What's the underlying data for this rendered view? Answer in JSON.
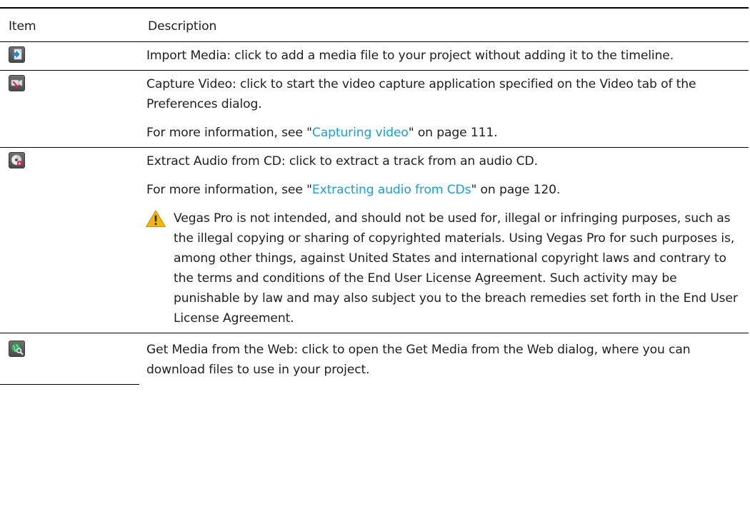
{
  "table": {
    "header": {
      "item": "Item",
      "description": "Description"
    },
    "rows": [
      {
        "icon": "import-media-icon",
        "paragraphs": [
          "Import Media: click to add a media file to your project without adding it to the timeline."
        ]
      },
      {
        "icon": "capture-video-icon",
        "paragraphs": [
          "Capture Video: click to start the video capture application specified on the Video tab of the Preferences dialog."
        ],
        "more_info": {
          "prefix": "For more information, see \"",
          "link": "Capturing video",
          "suffix": "\" on page 111."
        }
      },
      {
        "icon": "extract-audio-cd-icon",
        "paragraphs": [
          "Extract Audio from CD: click to extract a track from an audio CD."
        ],
        "more_info": {
          "prefix": "For more information, see \"",
          "link": "Extracting audio from CDs",
          "suffix": "\" on page 120."
        },
        "warning": {
          "icon": "warning-icon",
          "text": "Vegas Pro is not intended, and should not be used for, illegal or infringing purposes, such as the illegal copying or sharing of copyrighted materials. Using Vegas Pro for such purposes is, among other things, against United States and international copyright laws and contrary to the terms and conditions of the End User License Agreement. Such activity may be punishable by law and may also subject you to the breach remedies set forth in the End User License Agreement."
        }
      },
      {
        "icon": "get-media-web-icon",
        "paragraphs": [
          "Get Media from the Web: click to open the Get Media from the Web dialog, where you can download files to use in your project."
        ]
      }
    ]
  },
  "colors": {
    "link": "#1a9fd7",
    "text": "#1f1f1f",
    "warning": "#f2b705"
  }
}
